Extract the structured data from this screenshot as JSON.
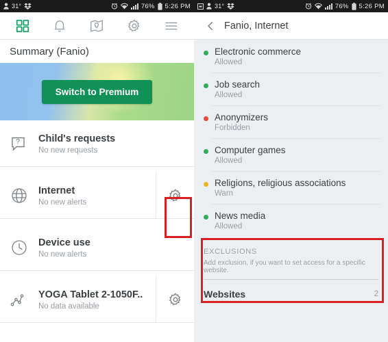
{
  "status_bar": {
    "temperature": "31°",
    "battery_percent": "76%",
    "time": "5:26 PM",
    "icons_left": [
      "contact-icon",
      "temperature-icon",
      "dropbox-icon"
    ],
    "icons_left_right_pane": [
      "screenshot-icon",
      "contact-icon",
      "temperature-icon",
      "dropbox-icon"
    ],
    "icons_right": [
      "alarm-icon",
      "wifi-icon",
      "signal-icon",
      "battery-icon"
    ]
  },
  "left_pane": {
    "toolbar": {
      "items": [
        {
          "name": "dashboard-icon",
          "active": true
        },
        {
          "name": "notifications-bell-icon",
          "active": false
        },
        {
          "name": "map-location-icon",
          "active": false
        },
        {
          "name": "settings-gear-icon",
          "active": false
        },
        {
          "name": "menu-hamburger-icon",
          "active": false
        }
      ]
    },
    "title": "Summary (Fanio)",
    "banner": {
      "button_label": "Switch to Premium",
      "button_color": "#109157"
    },
    "rows": [
      {
        "icon": "question-bubble-icon",
        "title": "Child's requests",
        "subtitle": "No new requests",
        "has_gear": false,
        "gear_highlighted": false
      },
      {
        "icon": "globe-icon",
        "title": "Internet",
        "subtitle": "No new alerts",
        "has_gear": true,
        "gear_highlighted": true
      },
      {
        "icon": "clock-icon",
        "title": "Device use",
        "subtitle": "No new alerts",
        "has_gear": false,
        "gear_highlighted": false
      },
      {
        "icon": "activity-graph-icon",
        "title": "YOGA Tablet 2-1050F..",
        "subtitle": "No data available",
        "has_gear": true,
        "gear_highlighted": false
      }
    ]
  },
  "right_pane": {
    "header": {
      "back_icon": "chevron-left-icon",
      "title": "Fanio, Internet"
    },
    "categories": [
      {
        "name": "Electronic commerce",
        "status": "Allowed",
        "dot_color": "#2eab55"
      },
      {
        "name": "Job search",
        "status": "Allowed",
        "dot_color": "#2eab55"
      },
      {
        "name": "Anonymizers",
        "status": "Forbidden",
        "dot_color": "#e74c3c"
      },
      {
        "name": "Computer games",
        "status": "Allowed",
        "dot_color": "#2eab55"
      },
      {
        "name": "Religions, religious associations",
        "status": "Warn",
        "dot_color": "#f0b429"
      },
      {
        "name": "News media",
        "status": "Allowed",
        "dot_color": "#2eab55"
      }
    ],
    "exclusions": {
      "heading": "EXCLUSIONS",
      "description": "Add exclusion, if you want to set access for a specific website.",
      "item_label": "Websites",
      "item_count": "2",
      "highlight_color": "#d81f22"
    }
  }
}
